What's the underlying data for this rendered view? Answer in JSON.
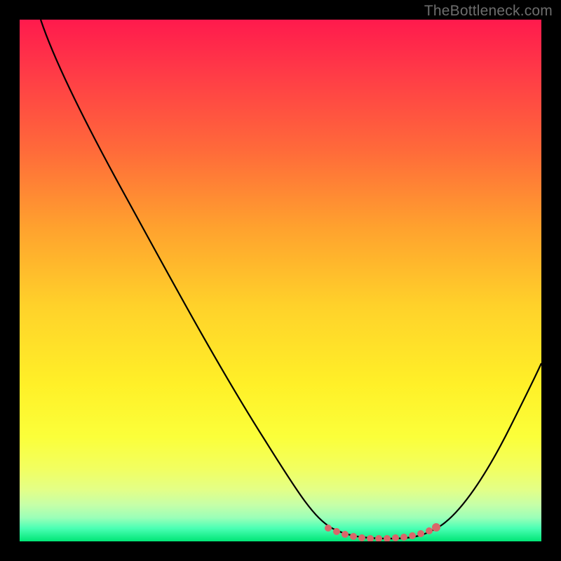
{
  "watermark": "TheBottleneck.com",
  "chart_data": {
    "type": "line",
    "title": "",
    "xlabel": "",
    "ylabel": "",
    "xlim": [
      0,
      100
    ],
    "ylim": [
      0,
      100
    ],
    "grid": false,
    "legend": false,
    "series": [
      {
        "name": "bottleneck-curve",
        "x": [
          4,
          10,
          20,
          30,
          40,
          50,
          56,
          60,
          64,
          70,
          74,
          78,
          82,
          90,
          100
        ],
        "y": [
          100,
          89,
          72,
          54,
          37,
          19,
          8,
          3,
          1,
          0.5,
          0.5,
          1,
          2.5,
          13,
          34
        ]
      },
      {
        "name": "optimum-dots",
        "x": [
          59,
          61,
          63,
          65,
          67,
          69,
          71,
          73,
          75,
          77,
          79
        ],
        "y": [
          2.6,
          2.0,
          1.5,
          1.1,
          0.9,
          0.9,
          1.0,
          1.1,
          1.4,
          1.9,
          2.6
        ]
      }
    ],
    "background_gradient": {
      "top": "#ff1a4d",
      "mid": "#ffd22a",
      "bottom": "#00e676"
    },
    "annotations": []
  }
}
